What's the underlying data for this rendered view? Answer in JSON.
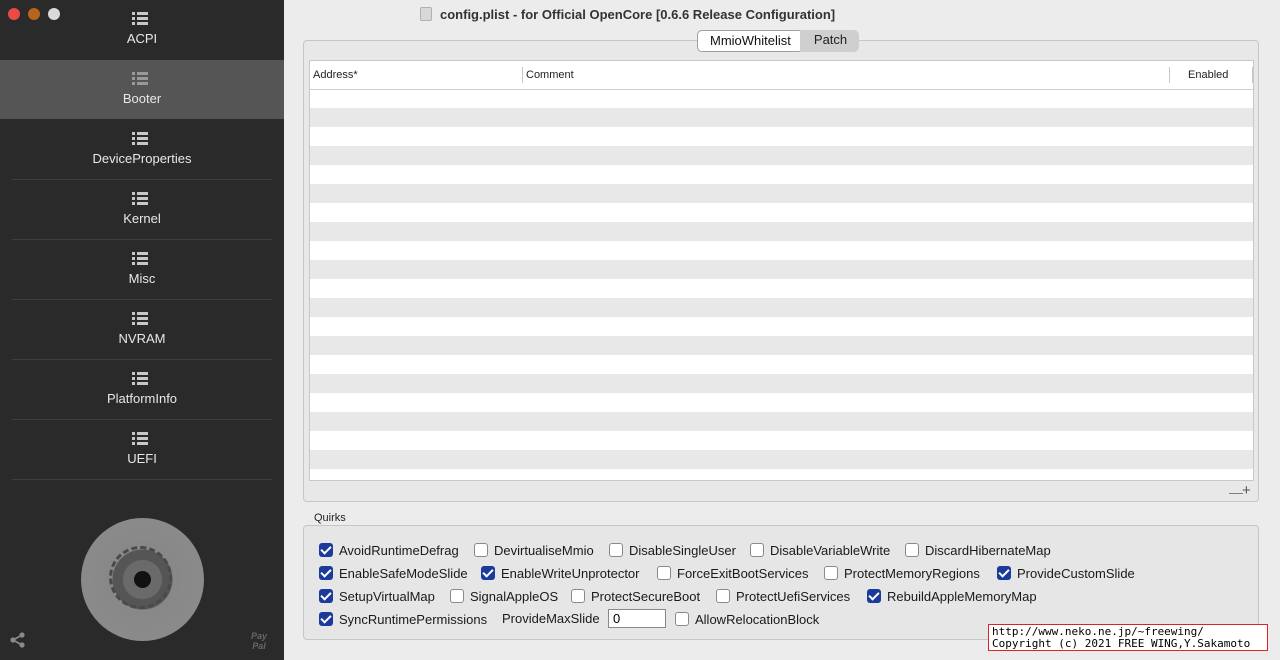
{
  "window": {
    "title": "config.plist - for Official OpenCore [0.6.6 Release Configuration]"
  },
  "sidebar": {
    "selected": "Booter",
    "items": [
      {
        "label": "ACPI"
      },
      {
        "label": "Booter"
      },
      {
        "label": "DeviceProperties"
      },
      {
        "label": "Kernel"
      },
      {
        "label": "Misc"
      },
      {
        "label": "NVRAM"
      },
      {
        "label": "PlatformInfo"
      },
      {
        "label": "UEFI"
      }
    ],
    "paypal_line1": "Pay",
    "paypal_line2": "Pal"
  },
  "tabs": {
    "mmio": "MmioWhitelist",
    "patch": "Patch",
    "active": "MmioWhitelist"
  },
  "table": {
    "columns": {
      "address": "Address*",
      "comment": "Comment",
      "enabled": "Enabled"
    },
    "rows": []
  },
  "footer_buttons": {
    "minus": "—",
    "plus": "+"
  },
  "quirks": {
    "label": "Quirks",
    "items": [
      {
        "label": "AvoidRuntimeDefrag",
        "checked": true
      },
      {
        "label": "DevirtualiseMmio",
        "checked": false
      },
      {
        "label": "DisableSingleUser",
        "checked": false
      },
      {
        "label": "DisableVariableWrite",
        "checked": false
      },
      {
        "label": "DiscardHibernateMap",
        "checked": false
      },
      {
        "label": "EnableSafeModeSlide",
        "checked": true
      },
      {
        "label": "EnableWriteUnprotector",
        "checked": true
      },
      {
        "label": "ForceExitBootServices",
        "checked": false
      },
      {
        "label": "ProtectMemoryRegions",
        "checked": false
      },
      {
        "label": "ProvideCustomSlide",
        "checked": true
      },
      {
        "label": "SetupVirtualMap",
        "checked": true
      },
      {
        "label": "SignalAppleOS",
        "checked": false
      },
      {
        "label": "ProtectSecureBoot",
        "checked": false
      },
      {
        "label": "ProtectUefiServices",
        "checked": false
      },
      {
        "label": "RebuildAppleMemoryMap",
        "checked": true
      },
      {
        "label": "SyncRuntimePermissions",
        "checked": true
      },
      {
        "label": "AllowRelocationBlock",
        "checked": false
      }
    ],
    "provide_max_slide_label": "ProvideMaxSlide",
    "provide_max_slide_value": "0"
  },
  "watermark": {
    "line1": "http://www.neko.ne.jp/~freewing/",
    "line2": "Copyright (c) 2021 FREE WING,Y.Sakamoto"
  },
  "colors": {
    "sidebar_bg": "#2a2a2a",
    "sidebar_selected": "#555555",
    "checkbox_checked": "#1a3a9c"
  }
}
